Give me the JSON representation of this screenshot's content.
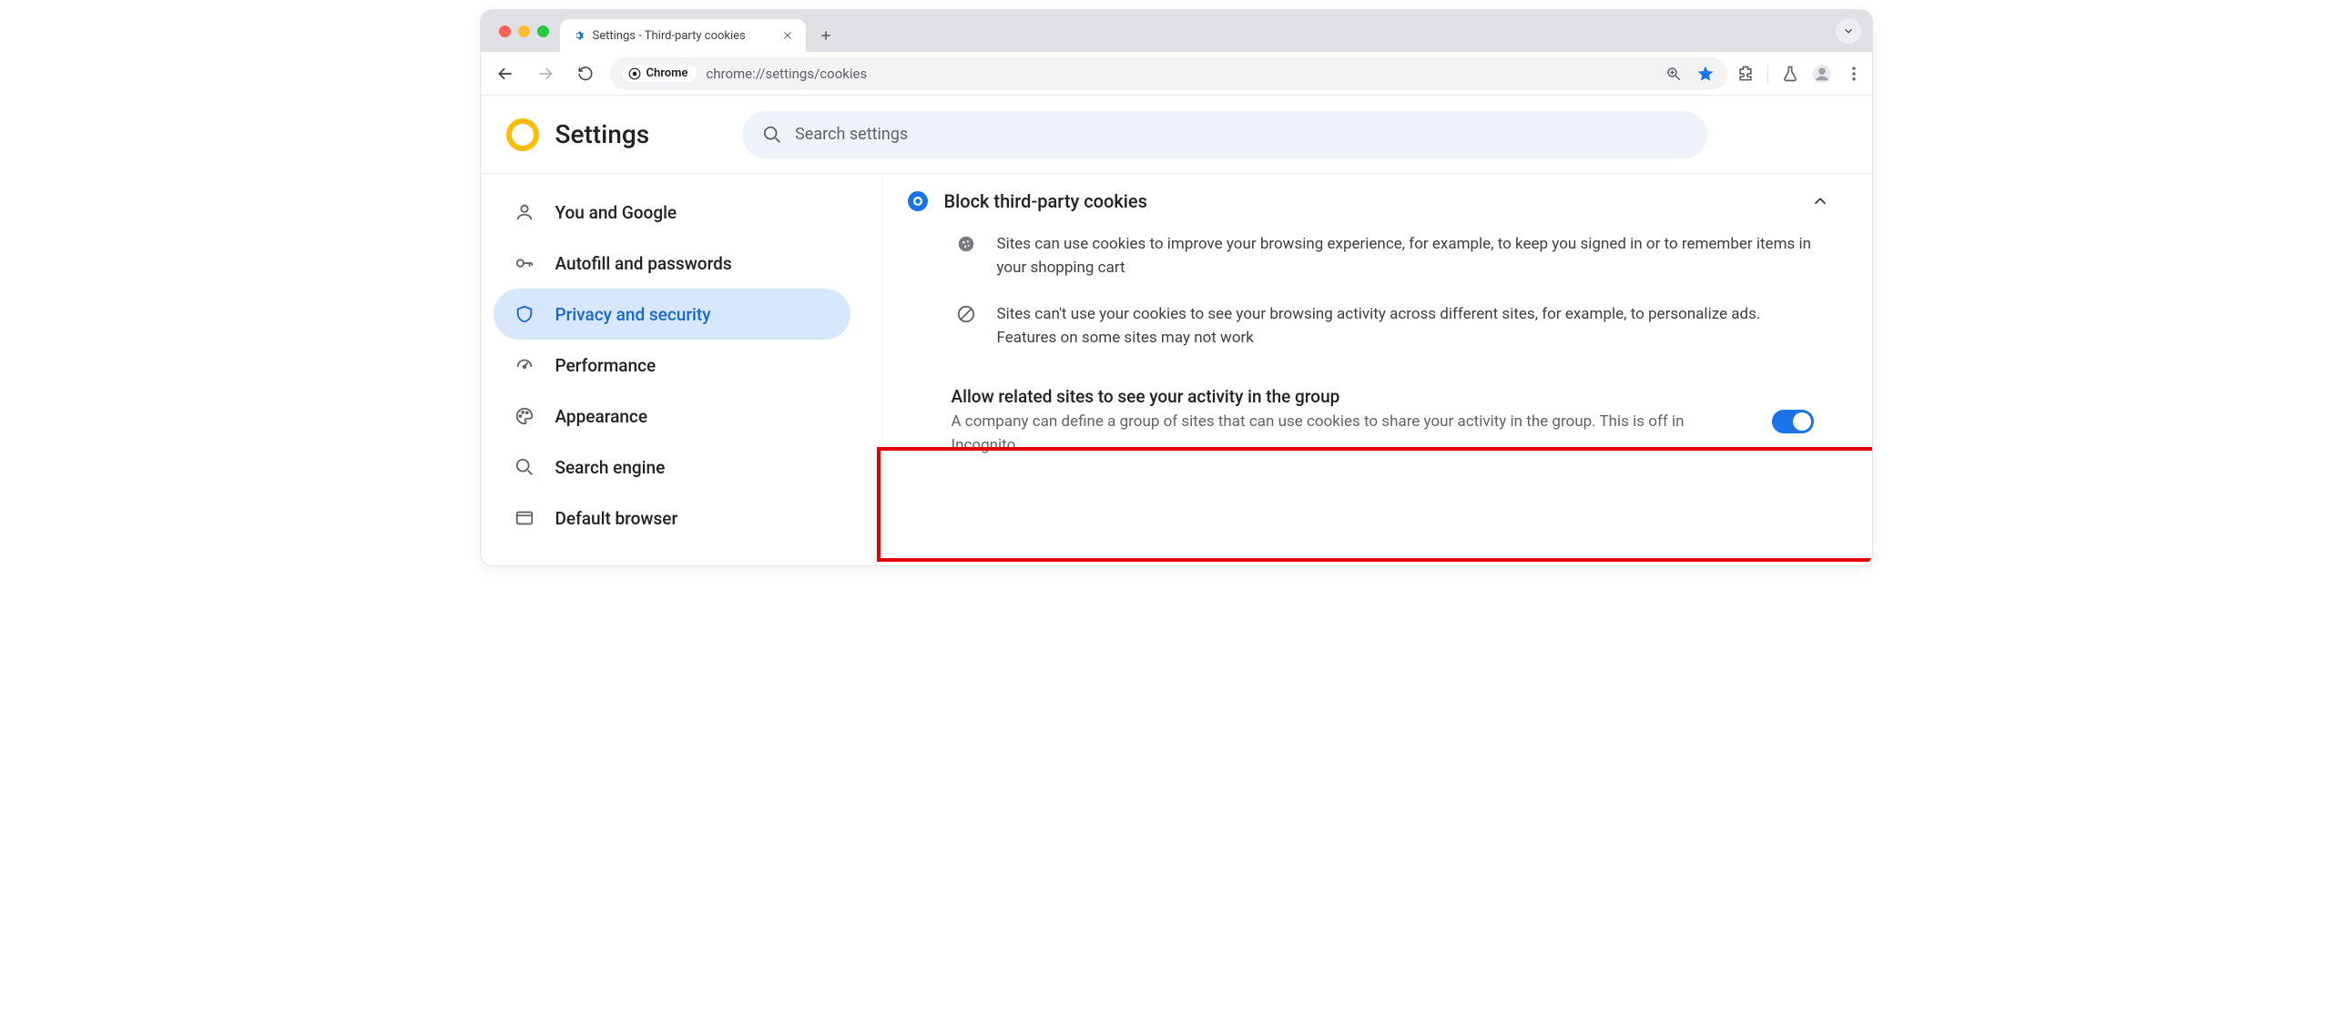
{
  "chrome": {
    "tab_title": "Settings - Third-party cookies",
    "omnibox_label": "Chrome",
    "url": "chrome://settings/cookies"
  },
  "header": {
    "title": "Settings",
    "search_placeholder": "Search settings"
  },
  "sidebar": {
    "items": [
      {
        "label": "You and Google"
      },
      {
        "label": "Autofill and passwords"
      },
      {
        "label": "Privacy and security"
      },
      {
        "label": "Performance"
      },
      {
        "label": "Appearance"
      },
      {
        "label": "Search engine"
      },
      {
        "label": "Default browser"
      }
    ],
    "selected_index": 2
  },
  "main": {
    "option": {
      "label": "Block third-party cookies"
    },
    "sub1": "Sites can use cookies to improve your browsing experience, for example, to keep you signed in or to remember items in your shopping cart",
    "sub2": "Sites can't use your cookies to see your browsing activity across different sites, for example, to personalize ads. Features on some sites may not work",
    "toggle": {
      "title": "Allow related sites to see your activity in the group",
      "desc": "A company can define a group of sites that can use cookies to share your activity in the group. This is off in Incognito.",
      "on": true
    }
  }
}
